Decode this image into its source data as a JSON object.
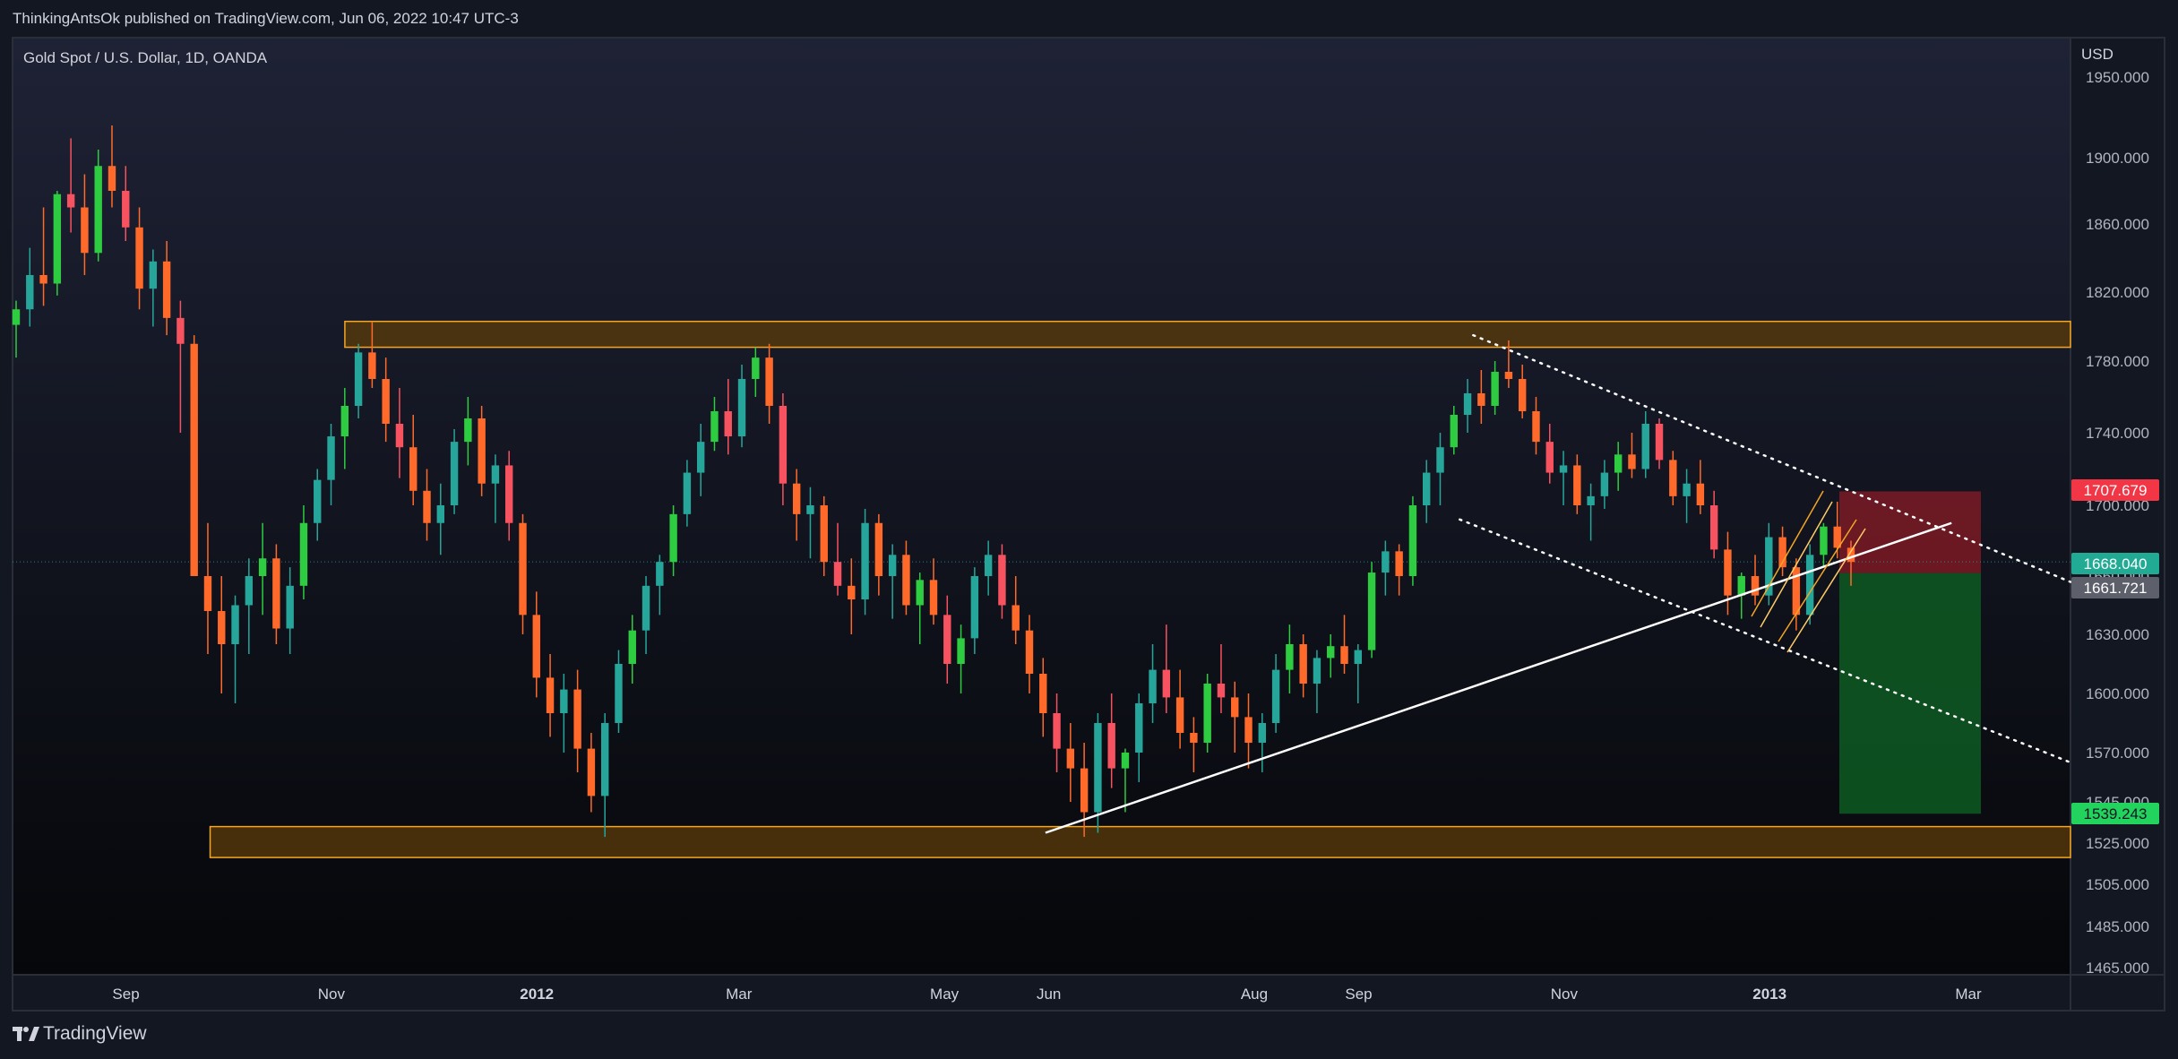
{
  "header": {
    "published_by": "ThinkingAntsOk published on TradingView.com, Jun 06, 2022 10:47 UTC-3"
  },
  "footer": {
    "logo_icon": "tradingview-logo-icon",
    "brand": "TradingView"
  },
  "colors": {
    "background_top": "#1e2235",
    "background_bottom": "#06070a",
    "bull": "#26a69a",
    "bull_bright": "#2ecc40",
    "bear": "#f7525f",
    "bear_orange": "#ff6a2b",
    "zone_fill": "#5c3c0a",
    "zone_stroke": "#f5a623",
    "trendline": "#ffffff",
    "stop_zone": "#8a1b26",
    "target_zone": "#0e5a22",
    "last_price_line": "#26a69a"
  },
  "chart_data": {
    "type": "candlestick",
    "title": "Gold Spot / U.S. Dollar, 1D, OANDA",
    "currency": "USD",
    "x_ticks": [
      "Sep",
      "Nov",
      "2012",
      "Mar",
      "May",
      "Jun",
      "Aug",
      "Sep",
      "Nov",
      "2013",
      "Mar"
    ],
    "y_ticks": [
      "1950.000",
      "1900.000",
      "1860.000",
      "1820.000",
      "1780.000",
      "1740.000",
      "1700.000",
      "1660.000",
      "1630.000",
      "1600.000",
      "1570.000",
      "1545.000",
      "1525.000",
      "1505.000",
      "1485.000",
      "1465.000"
    ],
    "ylim": [
      1460,
      1960
    ],
    "price_labels": [
      {
        "name": "stop",
        "value": "1707.679",
        "color": "#f23645",
        "text_color": "#ffffff"
      },
      {
        "name": "last",
        "value": "1668.040",
        "color": "#22ab94",
        "text_color": "#ffffff"
      },
      {
        "name": "entry",
        "value": "1661.721",
        "color": "#5d606b",
        "text_color": "#ffffff"
      },
      {
        "name": "target",
        "value": "1539.243",
        "color": "#22d35d",
        "text_color": "#131722"
      }
    ],
    "zones": [
      {
        "name": "resistance-zone",
        "x_from": "2011-11-05",
        "x_to": "right-edge",
        "y_top": 1803,
        "y_bottom": 1788
      },
      {
        "name": "support-zone",
        "x_from": "2011-09-26",
        "x_to": "right-edge",
        "y_top": 1533,
        "y_bottom": 1518
      }
    ],
    "trendlines": [
      {
        "name": "rising-support-line",
        "style": "solid",
        "from": [
          "2012-05-31",
          1530
        ],
        "to": [
          "2013-02-24",
          1690
        ]
      },
      {
        "name": "descending-channel-upper",
        "style": "dotted",
        "from": [
          "2012-10-05",
          1795
        ],
        "to": [
          "right-edge",
          1657
        ]
      },
      {
        "name": "descending-channel-lower",
        "style": "dotted",
        "from": [
          "2012-10-01",
          1692
        ],
        "to": [
          "right-edge",
          1565
        ]
      }
    ],
    "position": {
      "direction": "short",
      "entry": 1661.721,
      "stop": 1707.679,
      "target": 1539.243
    },
    "series": [
      {
        "name": "XAUUSD daily",
        "ohlc": [
          [
            1801,
            1815,
            1782,
            1810
          ],
          [
            1810,
            1846,
            1800,
            1830
          ],
          [
            1830,
            1870,
            1812,
            1825
          ],
          [
            1825,
            1880,
            1818,
            1878
          ],
          [
            1878,
            1912,
            1855,
            1870
          ],
          [
            1870,
            1890,
            1830,
            1843
          ],
          [
            1843,
            1905,
            1838,
            1895
          ],
          [
            1895,
            1920,
            1870,
            1880
          ],
          [
            1880,
            1895,
            1850,
            1858
          ],
          [
            1858,
            1870,
            1810,
            1822
          ],
          [
            1822,
            1845,
            1800,
            1838
          ],
          [
            1838,
            1850,
            1795,
            1805
          ],
          [
            1805,
            1815,
            1740,
            1790
          ],
          [
            1790,
            1795,
            1660,
            1660
          ],
          [
            1660,
            1690,
            1620,
            1642
          ],
          [
            1642,
            1660,
            1600,
            1625
          ],
          [
            1625,
            1650,
            1595,
            1645
          ],
          [
            1645,
            1670,
            1620,
            1660
          ],
          [
            1660,
            1690,
            1640,
            1670
          ],
          [
            1670,
            1678,
            1625,
            1633
          ],
          [
            1633,
            1665,
            1620,
            1655
          ],
          [
            1655,
            1700,
            1648,
            1690
          ],
          [
            1690,
            1720,
            1680,
            1714
          ],
          [
            1714,
            1745,
            1700,
            1738
          ],
          [
            1738,
            1765,
            1720,
            1755
          ],
          [
            1755,
            1790,
            1748,
            1785
          ],
          [
            1785,
            1803,
            1765,
            1770
          ],
          [
            1770,
            1782,
            1735,
            1745
          ],
          [
            1745,
            1765,
            1715,
            1732
          ],
          [
            1732,
            1750,
            1700,
            1708
          ],
          [
            1708,
            1720,
            1680,
            1690
          ],
          [
            1690,
            1712,
            1672,
            1700
          ],
          [
            1700,
            1742,
            1695,
            1735
          ],
          [
            1735,
            1760,
            1722,
            1748
          ],
          [
            1748,
            1755,
            1705,
            1712
          ],
          [
            1712,
            1728,
            1690,
            1722
          ],
          [
            1722,
            1730,
            1680,
            1690
          ],
          [
            1690,
            1695,
            1630,
            1640
          ],
          [
            1640,
            1652,
            1598,
            1608
          ],
          [
            1608,
            1620,
            1578,
            1590
          ],
          [
            1590,
            1610,
            1570,
            1602
          ],
          [
            1602,
            1612,
            1560,
            1572
          ],
          [
            1572,
            1580,
            1540,
            1548
          ],
          [
            1548,
            1590,
            1528,
            1585
          ],
          [
            1585,
            1622,
            1580,
            1615
          ],
          [
            1615,
            1640,
            1605,
            1632
          ],
          [
            1632,
            1660,
            1620,
            1655
          ],
          [
            1655,
            1672,
            1640,
            1668
          ],
          [
            1668,
            1700,
            1660,
            1695
          ],
          [
            1695,
            1725,
            1688,
            1718
          ],
          [
            1718,
            1745,
            1705,
            1735
          ],
          [
            1735,
            1760,
            1730,
            1752
          ],
          [
            1752,
            1770,
            1728,
            1738
          ],
          [
            1738,
            1778,
            1732,
            1770
          ],
          [
            1770,
            1788,
            1760,
            1782
          ],
          [
            1782,
            1790,
            1745,
            1755
          ],
          [
            1755,
            1762,
            1700,
            1712
          ],
          [
            1712,
            1720,
            1680,
            1695
          ],
          [
            1695,
            1710,
            1670,
            1700
          ],
          [
            1700,
            1705,
            1660,
            1668
          ],
          [
            1668,
            1690,
            1650,
            1655
          ],
          [
            1655,
            1670,
            1630,
            1648
          ],
          [
            1648,
            1698,
            1640,
            1690
          ],
          [
            1690,
            1695,
            1650,
            1660
          ],
          [
            1660,
            1678,
            1638,
            1672
          ],
          [
            1672,
            1680,
            1640,
            1645
          ],
          [
            1645,
            1662,
            1625,
            1658
          ],
          [
            1658,
            1670,
            1635,
            1640
          ],
          [
            1640,
            1650,
            1605,
            1615
          ],
          [
            1615,
            1635,
            1600,
            1628
          ],
          [
            1628,
            1665,
            1620,
            1660
          ],
          [
            1660,
            1680,
            1650,
            1672
          ],
          [
            1672,
            1678,
            1638,
            1645
          ],
          [
            1645,
            1660,
            1625,
            1632
          ],
          [
            1632,
            1640,
            1600,
            1610
          ],
          [
            1610,
            1618,
            1578,
            1590
          ],
          [
            1590,
            1600,
            1560,
            1572
          ],
          [
            1572,
            1585,
            1545,
            1562
          ],
          [
            1562,
            1575,
            1528,
            1540
          ],
          [
            1540,
            1590,
            1530,
            1585
          ],
          [
            1585,
            1600,
            1552,
            1562
          ],
          [
            1562,
            1572,
            1540,
            1570
          ],
          [
            1570,
            1600,
            1555,
            1595
          ],
          [
            1595,
            1625,
            1585,
            1612
          ],
          [
            1612,
            1635,
            1590,
            1598
          ],
          [
            1598,
            1612,
            1572,
            1580
          ],
          [
            1580,
            1588,
            1560,
            1575
          ],
          [
            1575,
            1610,
            1570,
            1605
          ],
          [
            1605,
            1625,
            1590,
            1598
          ],
          [
            1598,
            1606,
            1570,
            1588
          ],
          [
            1588,
            1600,
            1562,
            1575
          ],
          [
            1575,
            1590,
            1560,
            1585
          ],
          [
            1585,
            1620,
            1580,
            1612
          ],
          [
            1612,
            1635,
            1600,
            1625
          ],
          [
            1625,
            1630,
            1598,
            1605
          ],
          [
            1605,
            1622,
            1590,
            1618
          ],
          [
            1618,
            1630,
            1608,
            1624
          ],
          [
            1624,
            1640,
            1610,
            1615
          ],
          [
            1615,
            1625,
            1595,
            1622
          ],
          [
            1622,
            1668,
            1618,
            1662
          ],
          [
            1662,
            1680,
            1650,
            1674
          ],
          [
            1674,
            1678,
            1650,
            1660
          ],
          [
            1660,
            1705,
            1655,
            1700
          ],
          [
            1700,
            1725,
            1690,
            1718
          ],
          [
            1718,
            1740,
            1700,
            1732
          ],
          [
            1732,
            1755,
            1728,
            1750
          ],
          [
            1750,
            1770,
            1740,
            1762
          ],
          [
            1762,
            1775,
            1745,
            1755
          ],
          [
            1755,
            1780,
            1750,
            1774
          ],
          [
            1774,
            1792,
            1765,
            1770
          ],
          [
            1770,
            1778,
            1748,
            1752
          ],
          [
            1752,
            1760,
            1728,
            1735
          ],
          [
            1735,
            1745,
            1712,
            1718
          ],
          [
            1718,
            1730,
            1700,
            1722
          ],
          [
            1722,
            1728,
            1695,
            1700
          ],
          [
            1700,
            1712,
            1680,
            1705
          ],
          [
            1705,
            1725,
            1698,
            1718
          ],
          [
            1718,
            1735,
            1708,
            1728
          ],
          [
            1728,
            1740,
            1715,
            1720
          ],
          [
            1720,
            1752,
            1715,
            1745
          ],
          [
            1745,
            1748,
            1720,
            1725
          ],
          [
            1725,
            1730,
            1700,
            1705
          ],
          [
            1705,
            1720,
            1690,
            1712
          ],
          [
            1712,
            1725,
            1695,
            1700
          ],
          [
            1700,
            1708,
            1670,
            1675
          ],
          [
            1675,
            1685,
            1640,
            1650
          ],
          [
            1650,
            1662,
            1638,
            1660
          ],
          [
            1660,
            1672,
            1645,
            1650
          ],
          [
            1650,
            1690,
            1645,
            1682
          ],
          [
            1682,
            1688,
            1660,
            1665
          ],
          [
            1665,
            1670,
            1632,
            1640
          ],
          [
            1640,
            1678,
            1635,
            1672
          ],
          [
            1672,
            1690,
            1665,
            1688
          ],
          [
            1688,
            1702,
            1670,
            1676
          ],
          [
            1676,
            1680,
            1655,
            1668
          ]
        ]
      }
    ]
  }
}
